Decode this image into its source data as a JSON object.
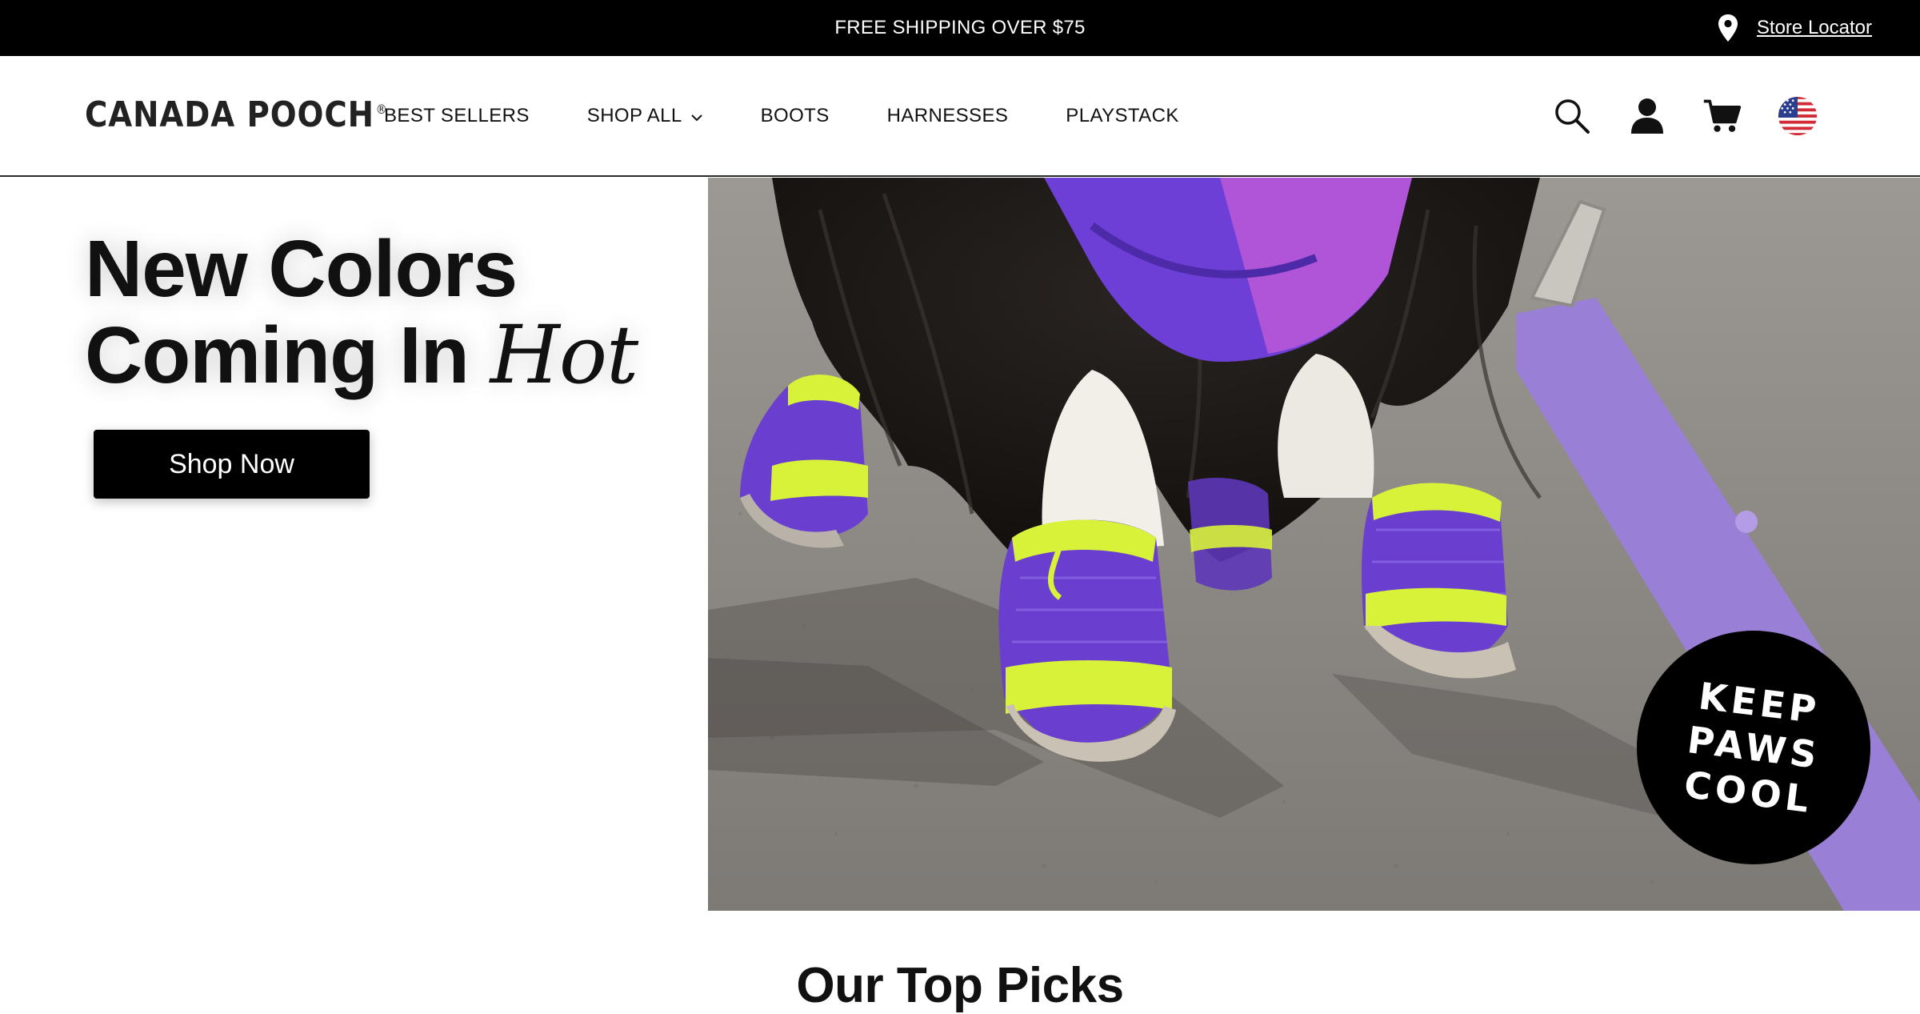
{
  "announcement": {
    "text": "FREE SHIPPING OVER $75",
    "store_locator": "Store Locator"
  },
  "header": {
    "logo": "CANADA POOCH",
    "logo_mark": "®",
    "nav": [
      {
        "label": "BEST SELLERS"
      },
      {
        "label": "SHOP ALL"
      },
      {
        "label": "BOOTS"
      },
      {
        "label": "HARNESSES"
      },
      {
        "label": "PLAYSTACK"
      }
    ],
    "icons": [
      "search-icon",
      "account-icon",
      "cart-icon",
      "us-flag-icon"
    ]
  },
  "hero": {
    "headline_line1": "New Colors",
    "headline_line2": "Coming In",
    "headline_italic": "Hot",
    "cta": "Shop Now",
    "badge_line1": "KEEP",
    "badge_line2": "PAWS",
    "badge_line3": "COOL"
  },
  "section": {
    "title": "Our Top Picks"
  },
  "colors": {
    "bar": "#000000",
    "boot_purple": "#6a3fd0",
    "boot_lime": "#d8f23a",
    "leash_lilac": "#9a7fd6"
  }
}
